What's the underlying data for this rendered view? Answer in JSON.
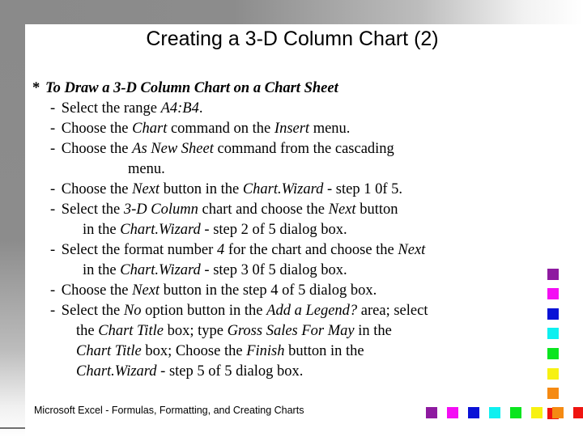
{
  "slide": {
    "title": "Creating a 3-D Column Chart (2)",
    "footer": "Microsoft  Excel - Formulas, Formatting, and Creating Charts",
    "bullet_marker": "*",
    "dash": "-"
  },
  "content": {
    "heading": "To Draw a 3-D Column Chart on a Chart Sheet",
    "items": [
      {
        "id": "select-range",
        "lines": [
          [
            {
              "t": "Select the range ",
              "i": false
            },
            {
              "t": "A4:B4",
              "i": true
            },
            {
              "t": ".",
              "i": false
            }
          ]
        ]
      },
      {
        "id": "choose-chart-command",
        "lines": [
          [
            {
              "t": "Choose the ",
              "i": false
            },
            {
              "t": "Chart",
              "i": true
            },
            {
              "t": " command on the ",
              "i": false
            },
            {
              "t": "Insert",
              "i": true
            },
            {
              "t": " menu.",
              "i": false
            }
          ]
        ]
      },
      {
        "id": "choose-as-new-sheet",
        "lines": [
          [
            {
              "t": "Choose the ",
              "i": false
            },
            {
              "t": "As New Sheet",
              "i": true
            },
            {
              "t": " command from the cascading",
              "i": false
            }
          ],
          [
            {
              "t": "menu.",
              "i": false
            }
          ]
        ]
      },
      {
        "id": "next-step-1-of-5",
        "lines": [
          [
            {
              "t": "Choose the ",
              "i": false
            },
            {
              "t": "Next",
              "i": true
            },
            {
              "t": " button in the ",
              "i": false
            },
            {
              "t": "Chart.Wizard",
              "i": true
            },
            {
              "t": " - step 1 0f 5.",
              "i": false
            }
          ]
        ]
      },
      {
        "id": "select-3d-column-chart",
        "lines": [
          [
            {
              "t": "Select the ",
              "i": false
            },
            {
              "t": "3-D Column",
              "i": true
            },
            {
              "t": " chart and choose the ",
              "i": false
            },
            {
              "t": "Next",
              "i": true
            },
            {
              "t": " button",
              "i": false
            }
          ],
          [
            {
              "t": "in the ",
              "i": false
            },
            {
              "t": "Chart.Wizard",
              "i": true
            },
            {
              "t": " - step 2 of 5 dialog box.",
              "i": false
            }
          ]
        ]
      },
      {
        "id": "select-format-number-4",
        "lines": [
          [
            {
              "t": "Select the format number ",
              "i": false
            },
            {
              "t": "4",
              "i": true
            },
            {
              "t": " for the chart  and choose the ",
              "i": false
            },
            {
              "t": "Next",
              "i": true
            }
          ],
          [
            {
              "t": "in the ",
              "i": false
            },
            {
              "t": "Chart.Wizard",
              "i": true
            },
            {
              "t": " - step 3 0f 5 dialog box.",
              "i": false
            }
          ]
        ]
      },
      {
        "id": "next-step-4-of-5",
        "lines": [
          [
            {
              "t": "Choose the ",
              "i": false
            },
            {
              "t": "Next",
              "i": true
            },
            {
              "t": " button in the step 4 of 5 dialog box.",
              "i": false
            }
          ]
        ]
      },
      {
        "id": "select-no-add-legend",
        "lines": [
          [
            {
              "t": "Select the ",
              "i": false
            },
            {
              "t": "No",
              "i": true
            },
            {
              "t": " option button in the ",
              "i": false
            },
            {
              "t": "Add a Legend?",
              "i": true
            },
            {
              "t": " area; select",
              "i": false
            }
          ],
          [
            {
              "t": "the ",
              "i": false
            },
            {
              "t": "Chart Title",
              "i": true
            },
            {
              "t": " box; type ",
              "i": false
            },
            {
              "t": "Gross Sales For May",
              "i": true
            },
            {
              "t": " in the",
              "i": false
            }
          ],
          [
            {
              "t": "Chart Title",
              "i": true
            },
            {
              "t": " box; Choose the ",
              "i": false
            },
            {
              "t": "Finish",
              "i": true
            },
            {
              "t": " button in the",
              "i": false
            }
          ],
          [
            {
              "t": "Chart.Wizard",
              "i": true
            },
            {
              "t": " - step 5 of 5 dialog box.",
              "i": false
            }
          ]
        ]
      }
    ]
  },
  "decor": {
    "square_colors": [
      "#8e1aa0",
      "#f40df4",
      "#0a12d6",
      "#0ef0f0",
      "#0ae51f",
      "#f7f112",
      "#f58a12",
      "#ef1410"
    ],
    "right_strip_tops": [
      332,
      356,
      381,
      405,
      430,
      455,
      479,
      504
    ],
    "bottom_strip_lefts": [
      526,
      552,
      578,
      604,
      630,
      656,
      682,
      708
    ]
  }
}
